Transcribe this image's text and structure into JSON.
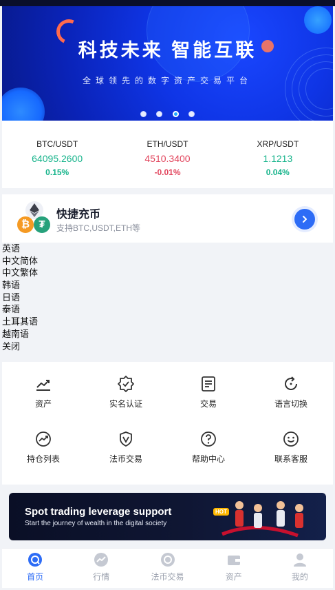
{
  "banner": {
    "title": "科技未来  智能互联",
    "subtitle": "全球领先的数字资产交易平台",
    "slides": 4,
    "active_slide": 3
  },
  "tickers": [
    {
      "pair": "BTC/USDT",
      "price": "64095.2600",
      "change": "0.15%",
      "trend": "up"
    },
    {
      "pair": "ETH/USDT",
      "price": "4510.3400",
      "change": "-0.01%",
      "trend": "down"
    },
    {
      "pair": "XRP/USDT",
      "price": "1.1213",
      "change": "0.04%",
      "trend": "up"
    }
  ],
  "quick_deposit": {
    "title": "快捷充币",
    "subtitle": "支持BTC,USDT,ETH等",
    "coin_icons": [
      "eth-icon",
      "btc-icon",
      "usdt-icon"
    ]
  },
  "language_menu": [
    "英语",
    "中文简体",
    "中文繁体",
    "韩语",
    "日语",
    "泰语",
    "土耳其语",
    "越南语",
    "关闭"
  ],
  "grid": [
    {
      "label": "资产",
      "icon": "assets-chart-icon"
    },
    {
      "label": "实名认证",
      "icon": "verified-badge-icon"
    },
    {
      "label": "交易",
      "icon": "trade-document-icon"
    },
    {
      "label": "语言切换",
      "icon": "refresh-icon"
    },
    {
      "label": "持仓列表",
      "icon": "trend-circle-icon"
    },
    {
      "label": "法币交易",
      "icon": "shield-v-icon"
    },
    {
      "label": "帮助中心",
      "icon": "help-icon"
    },
    {
      "label": "联系客服",
      "icon": "smile-icon"
    }
  ],
  "promo": {
    "headline": "Spot trading leverage support",
    "badge": "HOT",
    "tagline": "Start the journey of wealth in the digital society"
  },
  "tabbar": [
    {
      "label": "首页",
      "icon": "home-icon",
      "active": true
    },
    {
      "label": "行情",
      "icon": "market-icon",
      "active": false
    },
    {
      "label": "法币交易",
      "icon": "fiat-icon",
      "active": false
    },
    {
      "label": "资产",
      "icon": "wallet-icon",
      "active": false
    },
    {
      "label": "我的",
      "icon": "user-icon",
      "active": false
    }
  ],
  "colors": {
    "up": "#14b38a",
    "down": "#e2445c",
    "accent": "#2d6cf6"
  }
}
